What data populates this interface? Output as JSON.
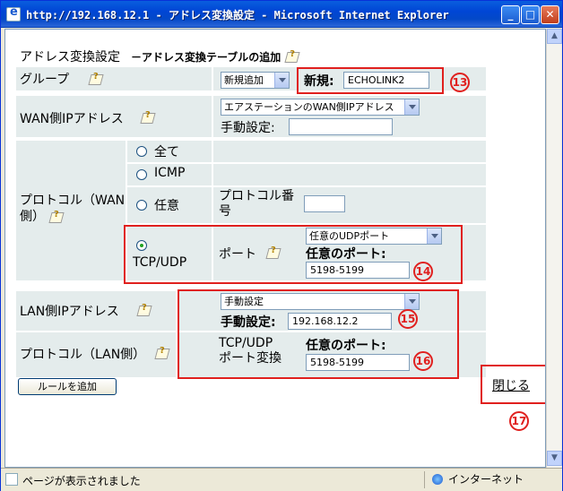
{
  "window": {
    "title": "http://192.168.12.1 - アドレス変換設定 - Microsoft Internet Explorer",
    "minimize": "_",
    "maximize": "□",
    "close": "✕"
  },
  "page": {
    "title": "アドレス変換設定",
    "subtitle": "－アドレス変換テーブルの追加"
  },
  "group": {
    "label": "グループ",
    "select_value": "新規追加",
    "new_label": "新規:",
    "new_value": "ECHOLINK2",
    "badge": "13"
  },
  "wan_ip": {
    "label": "WAN側IPアドレス",
    "select_value": "エアステーションのWAN側IPアドレス",
    "manual_label": "手動設定:",
    "manual_value": ""
  },
  "protocol_wan": {
    "label": "プロトコル（WAN側）",
    "options": [
      "全て",
      "ICMP",
      "任意",
      "TCP/UDP"
    ],
    "selected": "TCP/UDP",
    "proto_number_label": "プロトコル番号",
    "proto_number_value": "",
    "port_label": "ポート",
    "port_select_value": "任意のUDPポート",
    "any_port_label": "任意のポート:",
    "any_port_value": "5198-5199",
    "badge": "14"
  },
  "lan_ip": {
    "label": "LAN側IPアドレス",
    "select_value": "手動設定",
    "manual_label": "手動設定:",
    "manual_value": "192.168.12.2",
    "badge": "15"
  },
  "protocol_lan": {
    "label": "プロトコル（LAN側）",
    "port_conv_label": "TCP/UDP\nポート変換",
    "any_port_label": "任意のポート:",
    "any_port_value": "5198-5199",
    "badge": "16"
  },
  "actions": {
    "add_rule": "ルールを追加",
    "close": "閉じる",
    "badge": "17"
  },
  "status": {
    "text": "ページが表示されました",
    "zone": "インターネット"
  },
  "colors": {
    "cell_bg": "#e4ecec",
    "annotation_red": "#e0201e",
    "titlebar_blue": "#0046d5"
  }
}
